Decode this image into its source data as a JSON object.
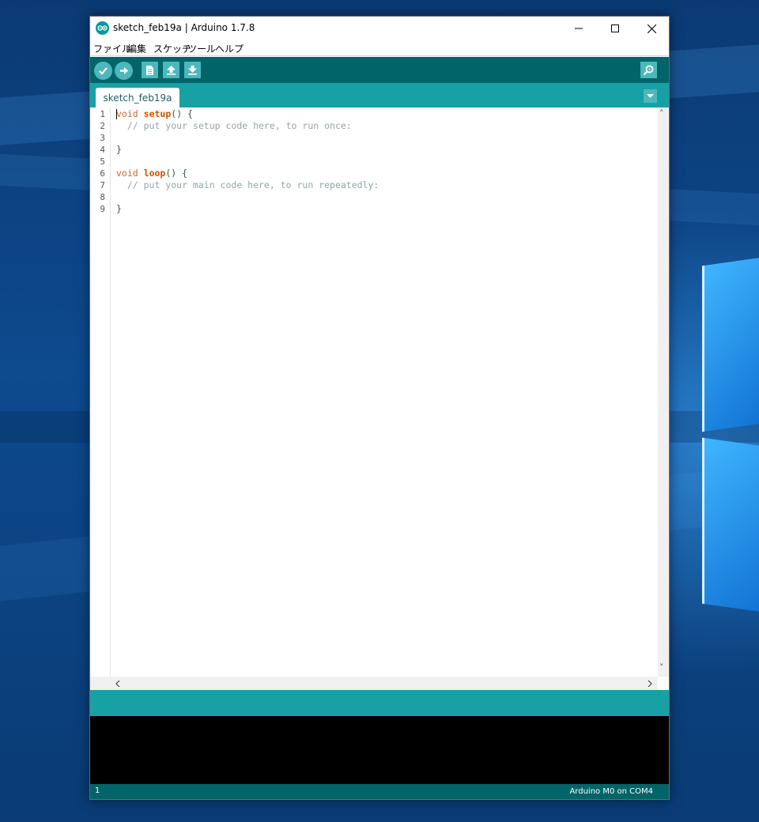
{
  "window": {
    "title": "sketch_feb19a | Arduino 1.7.8"
  },
  "menu": [
    "ファイル",
    "編集",
    "スケッチ",
    "ツール",
    "ヘルプ"
  ],
  "toolbar": {
    "buttons": [
      "verify-icon",
      "upload-icon",
      "new-icon",
      "open-icon",
      "save-icon"
    ],
    "serial_monitor": "serial-monitor-icon"
  },
  "tabs": [
    {
      "label": "sketch_feb19a",
      "active": true
    }
  ],
  "editor": {
    "line_numbers": [
      "1",
      "2",
      "3",
      "4",
      "5",
      "6",
      "7",
      "8",
      "9"
    ],
    "lines": [
      [
        {
          "t": "void",
          "c": "kw"
        },
        {
          "t": " ",
          "c": "plain"
        },
        {
          "t": "setup",
          "c": "fn"
        },
        {
          "t": "() {",
          "c": "plain"
        }
      ],
      [
        {
          "t": "  // put your setup code here, to run once:",
          "c": "cm"
        }
      ],
      [],
      [
        {
          "t": "}",
          "c": "plain"
        }
      ],
      [],
      [
        {
          "t": "void",
          "c": "kw"
        },
        {
          "t": " ",
          "c": "plain"
        },
        {
          "t": "loop",
          "c": "fn"
        },
        {
          "t": "() {",
          "c": "plain"
        }
      ],
      [
        {
          "t": "  // put your main code here, to run repeatedly:",
          "c": "cm"
        }
      ],
      [],
      [
        {
          "t": "}",
          "c": "plain"
        }
      ]
    ]
  },
  "status": {
    "line": "1",
    "board": "Arduino M0 on COM4"
  },
  "colors": {
    "toolbar": "#006468",
    "tabbar": "#17a1a5",
    "button": "#4db7bb",
    "keyword": "#cc6633",
    "function": "#d35400",
    "comment": "#95a5a6"
  }
}
